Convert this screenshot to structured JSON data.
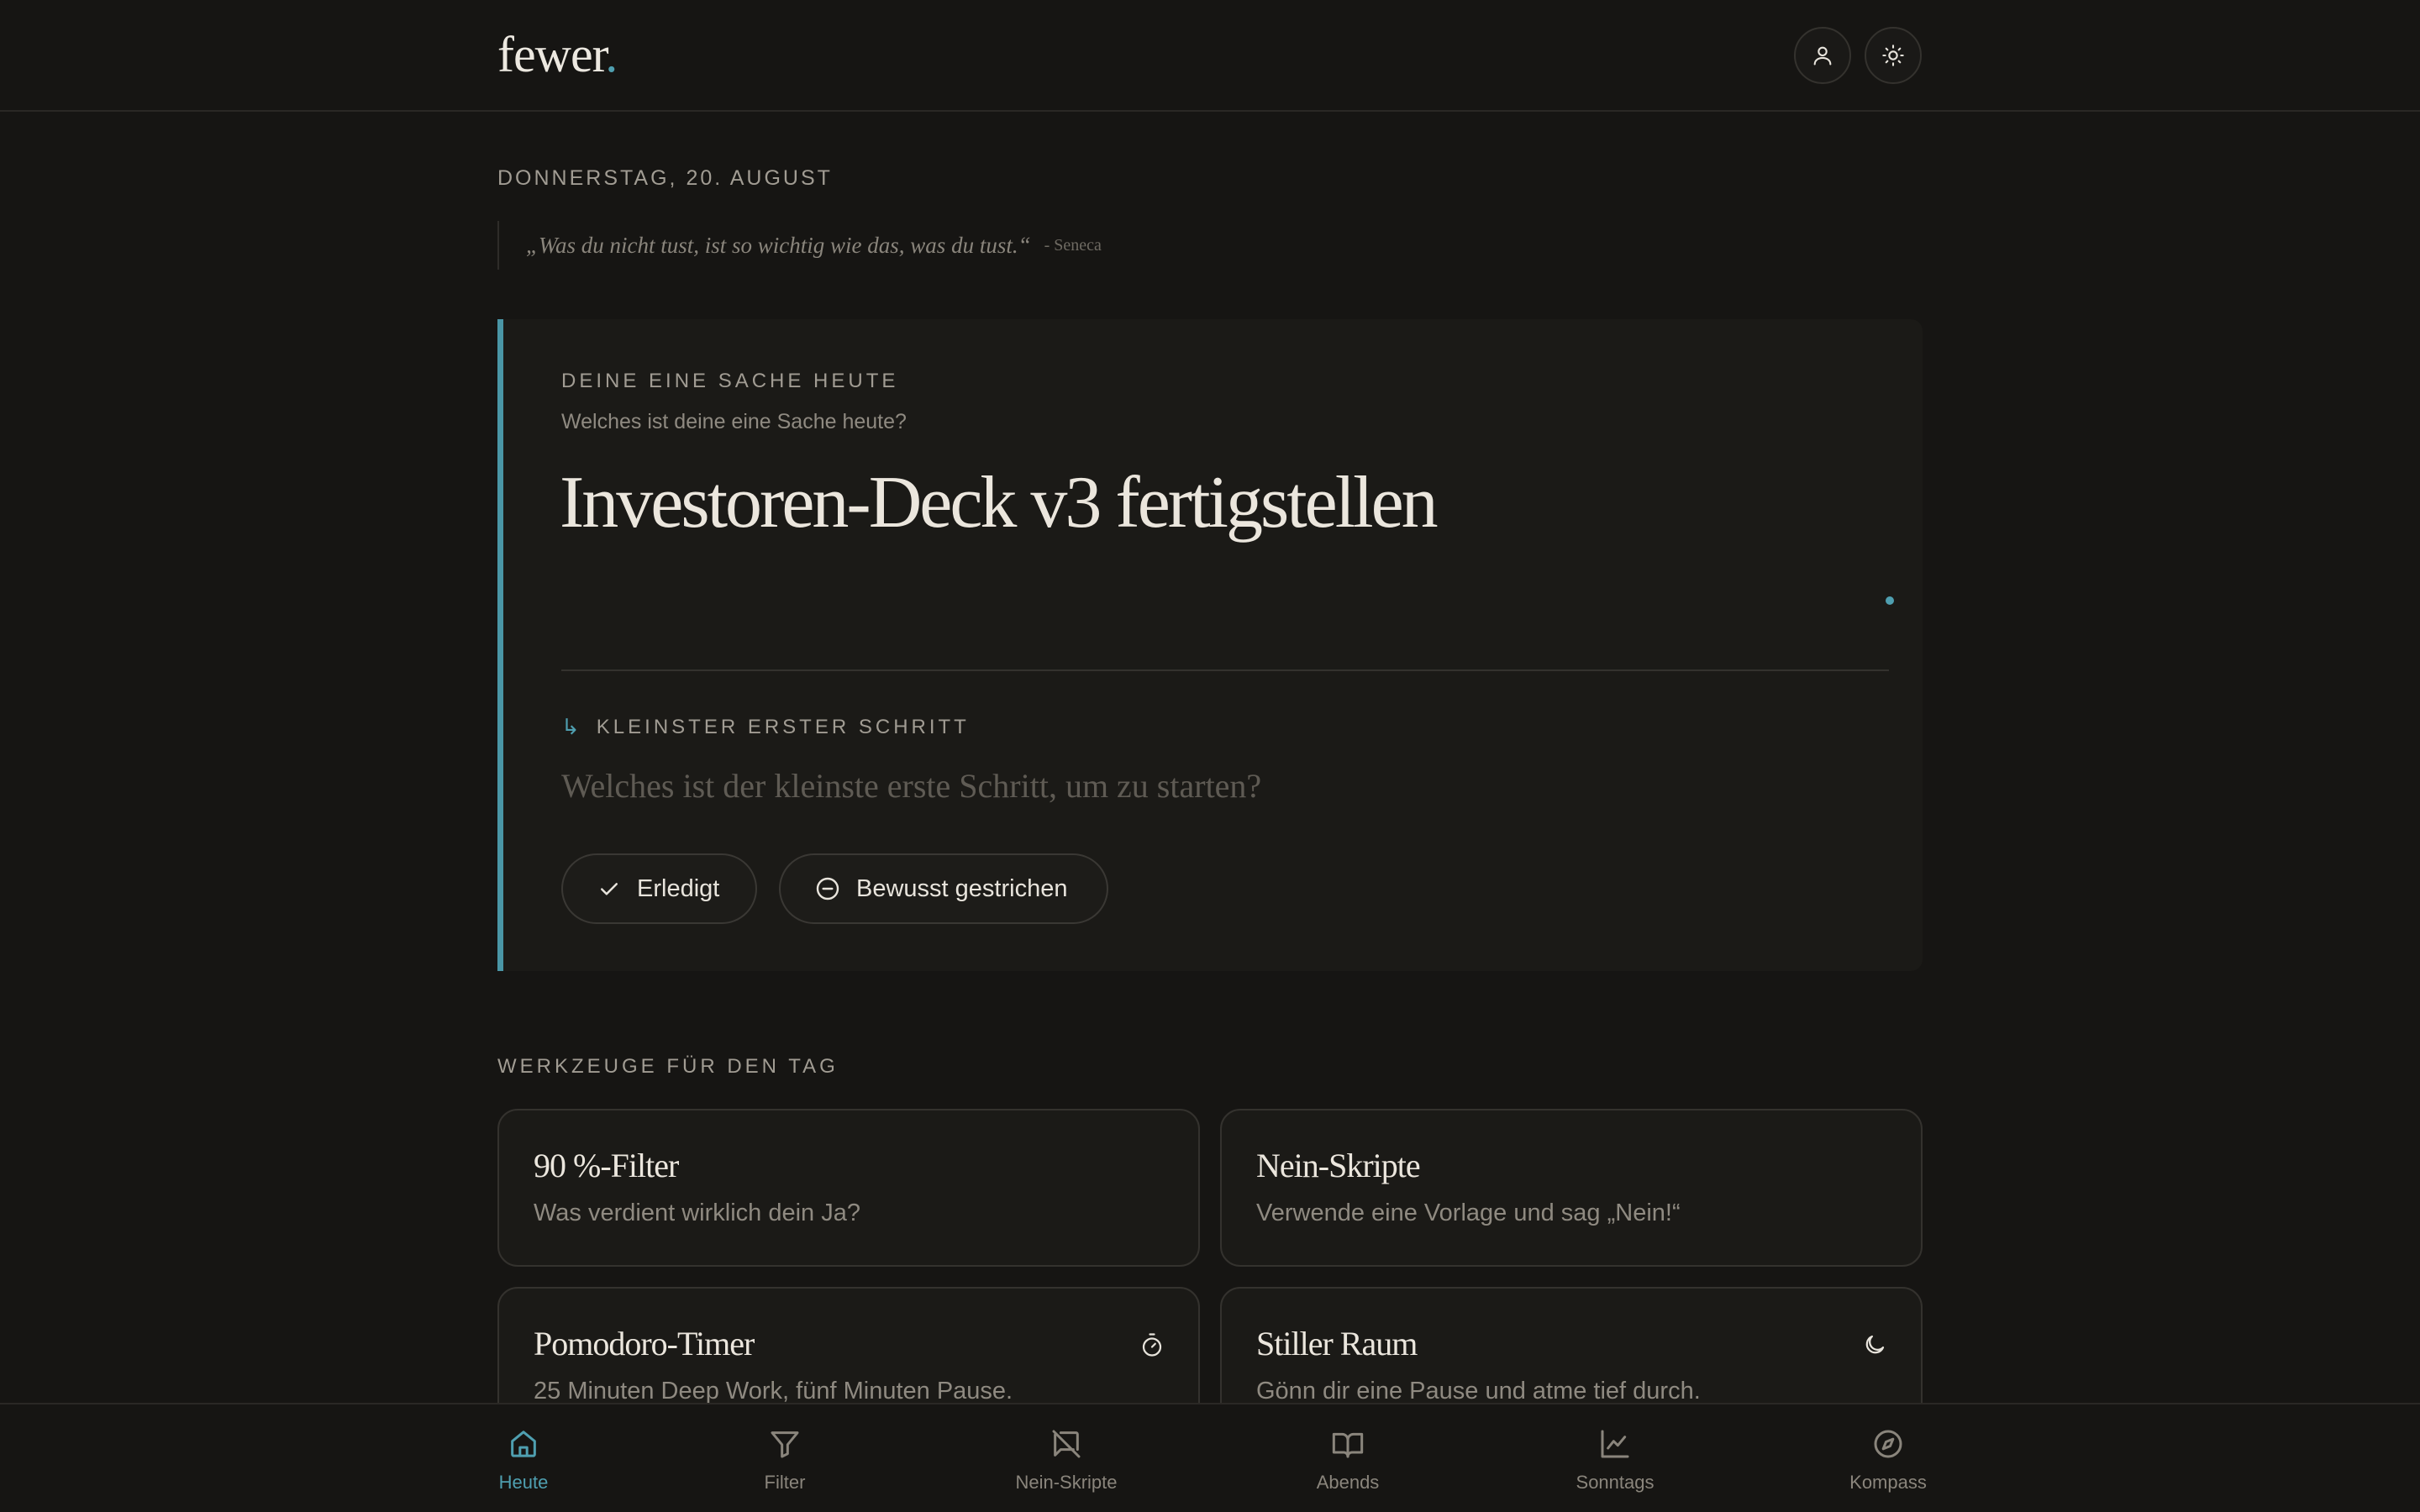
{
  "header": {
    "logo": "fewer",
    "logo_dot": ".",
    "accent_color": "#4f9fb0"
  },
  "date": "DONNERSTAG, 20. AUGUST",
  "quote": {
    "text": "„Was du nicht tust, ist so wichtig wie das, was du tust.“",
    "author": "- Seneca"
  },
  "focus": {
    "label": "DEINE EINE SACHE HEUTE",
    "question": "Welches ist deine eine Sache heute?",
    "title": "Investoren-Deck v3 fertigstellen",
    "step_arrow": "↳",
    "step_label": "KLEINSTER ERSTER SCHRITT",
    "step_placeholder": "Welches ist der kleinste erste Schritt, um zu starten?",
    "step_value": "",
    "done_label": "Erledigt",
    "skip_label": "Bewusst gestrichen"
  },
  "tools": {
    "label": "WERKZEUGE FÜR DEN TAG",
    "items": [
      {
        "title": "90 %-Filter",
        "desc": "Was verdient wirklich dein Ja?",
        "icon": ""
      },
      {
        "title": "Nein-Skripte",
        "desc": "Verwende eine Vorlage und sag „Nein!“",
        "icon": ""
      },
      {
        "title": "Pomodoro-Timer",
        "desc": "25 Minuten Deep Work, fünf Minuten Pause.",
        "icon": "timer-icon"
      },
      {
        "title": "Stiller Raum",
        "desc": "Gönn dir eine Pause und atme tief durch.",
        "icon": "moon-icon"
      }
    ]
  },
  "nav": {
    "active": "Heute",
    "items": [
      {
        "label": "Heute",
        "icon": "home-icon"
      },
      {
        "label": "Filter",
        "icon": "filter-icon"
      },
      {
        "label": "Nein-Skripte",
        "icon": "message-off-icon"
      },
      {
        "label": "Abends",
        "icon": "book-icon"
      },
      {
        "label": "Sonntags",
        "icon": "chart-icon"
      },
      {
        "label": "Kompass",
        "icon": "compass-icon"
      }
    ]
  }
}
